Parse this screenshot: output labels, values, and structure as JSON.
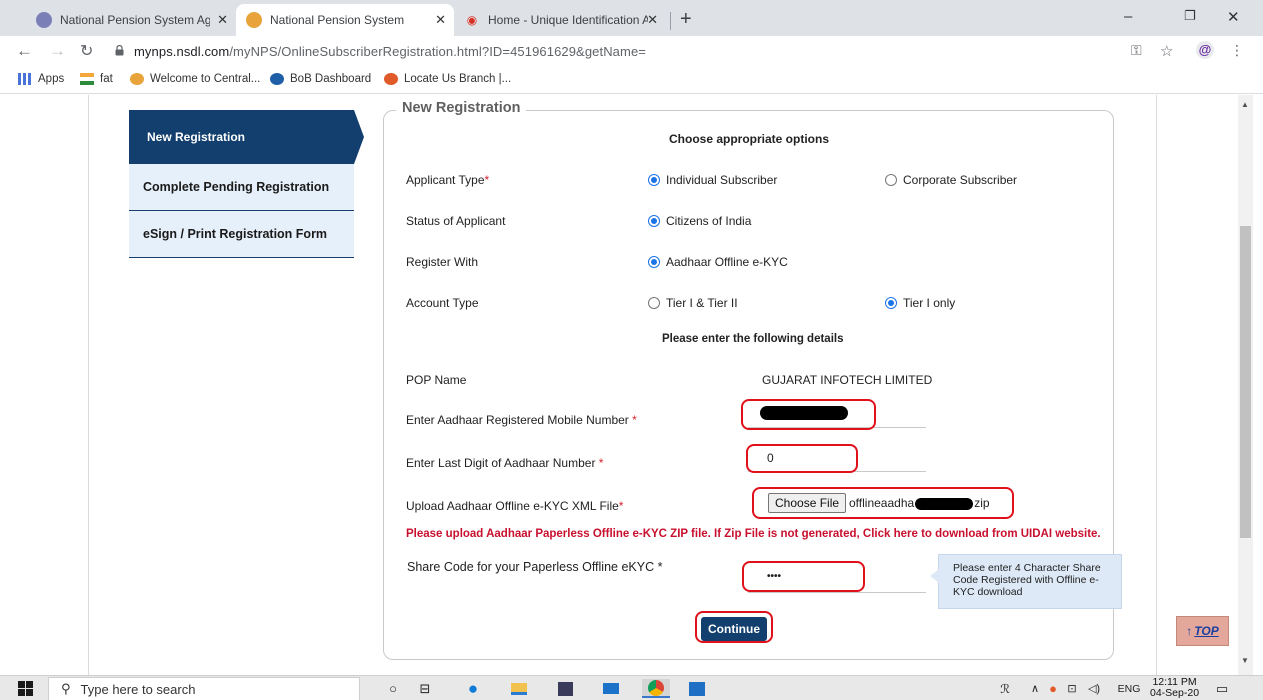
{
  "browser": {
    "tabs": [
      {
        "title": "National Pension System Agent, I",
        "active": false
      },
      {
        "title": "National Pension System",
        "active": true
      },
      {
        "title": "Home - Unique Identification Au",
        "active": false
      }
    ],
    "url_host": "mynps.nsdl.com",
    "url_path": "/myNPS/OnlineSubscriberRegistration.html?ID=451961629&getName=",
    "bookmarks": [
      "Apps",
      "fat",
      "Welcome to Central...",
      "BoB Dashboard",
      "Locate Us Branch |..."
    ]
  },
  "sidebar": {
    "items": [
      {
        "label": "New Registration",
        "active": true
      },
      {
        "label": "Complete Pending Registration",
        "active": false
      },
      {
        "label": "eSign / Print Registration Form",
        "active": false
      }
    ]
  },
  "form": {
    "legend": "New Registration",
    "choose_heading": "Choose appropriate options",
    "applicant_type": {
      "label": "Applicant Type",
      "options": [
        "Individual Subscriber",
        "Corporate Subscriber"
      ],
      "selected": "Individual Subscriber"
    },
    "status": {
      "label": "Status of Applicant",
      "options": [
        "Citizens of India"
      ],
      "selected": "Citizens of India"
    },
    "register_with": {
      "label": "Register With",
      "options": [
        "Aadhaar Offline e-KYC"
      ],
      "selected": "Aadhaar Offline e-KYC"
    },
    "account_type": {
      "label": "Account Type",
      "options": [
        "Tier I & Tier II",
        "Tier I only"
      ],
      "selected": "Tier I only"
    },
    "details_heading": "Please enter the following details",
    "pop_name": {
      "label": "POP Name",
      "value": "GUJARAT INFOTECH LIMITED"
    },
    "mobile": {
      "label": "Enter Aadhaar Registered Mobile Number"
    },
    "last_digit": {
      "label": "Enter Last Digit of Aadhaar Number",
      "value": "0"
    },
    "upload": {
      "label": "Upload Aadhaar Offline e-KYC XML File",
      "button": "Choose File",
      "file_prefix": "offlineaadha",
      "file_suffix": "zip"
    },
    "warning": "Please upload Aadhaar Paperless Offline e-KYC ZIP file. If Zip File is not generated, Click here to download from UIDAI website.",
    "share_code": {
      "label": "Share Code for your Paperless Offline eKYC",
      "value": "••••"
    },
    "tooltip": "Please enter 4 Character Share Code Registered with Offline e-KYC download",
    "continue_label": "Continue",
    "required_mark": "*"
  },
  "top_button": {
    "arrow": "↑",
    "label": "TOP"
  },
  "taskbar": {
    "search_placeholder": "Type here to search",
    "language": "ENG",
    "time": "12:11 PM",
    "date": "04-Sep-20"
  }
}
